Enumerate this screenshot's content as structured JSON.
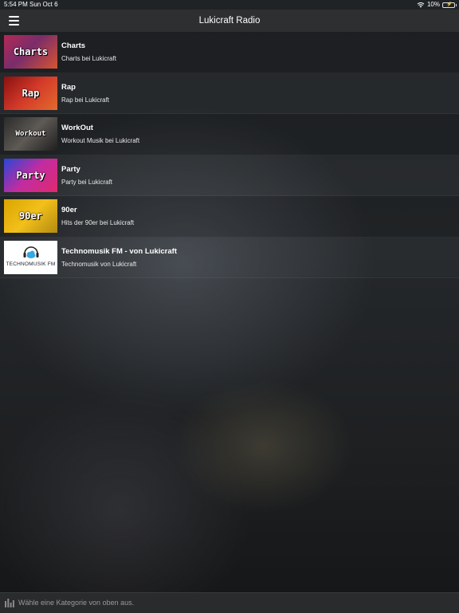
{
  "status": {
    "time": "5:54 PM",
    "date": "Sun Oct 6",
    "battery": "10%"
  },
  "nav": {
    "title": "Lukicraft Radio",
    "menu_icon": "hamburger-menu-icon"
  },
  "stations": [
    {
      "title": "Charts",
      "subtitle": "Charts bei Lukicraft",
      "thumb_text": "Charts"
    },
    {
      "title": "Rap",
      "subtitle": "Rap bei Lukicraft",
      "thumb_text": "Rap"
    },
    {
      "title": "WorkOut",
      "subtitle": "Workout Musik bei Lukicraft",
      "thumb_text": "Workout"
    },
    {
      "title": "Party",
      "subtitle": "Party bei Lukicraft",
      "thumb_text": "Party"
    },
    {
      "title": "90er",
      "subtitle": "Hits der 90er bei Lukicraft",
      "thumb_text": "90er"
    },
    {
      "title": "Technomusik FM - von Lukicraft",
      "subtitle": "Technomusik von Lukicraft",
      "thumb_text": "TECHNOMUSIK FM"
    }
  ],
  "bottom": {
    "message": "Wähle eine Kategorie von oben aus.",
    "icon": "equalizer-icon"
  }
}
